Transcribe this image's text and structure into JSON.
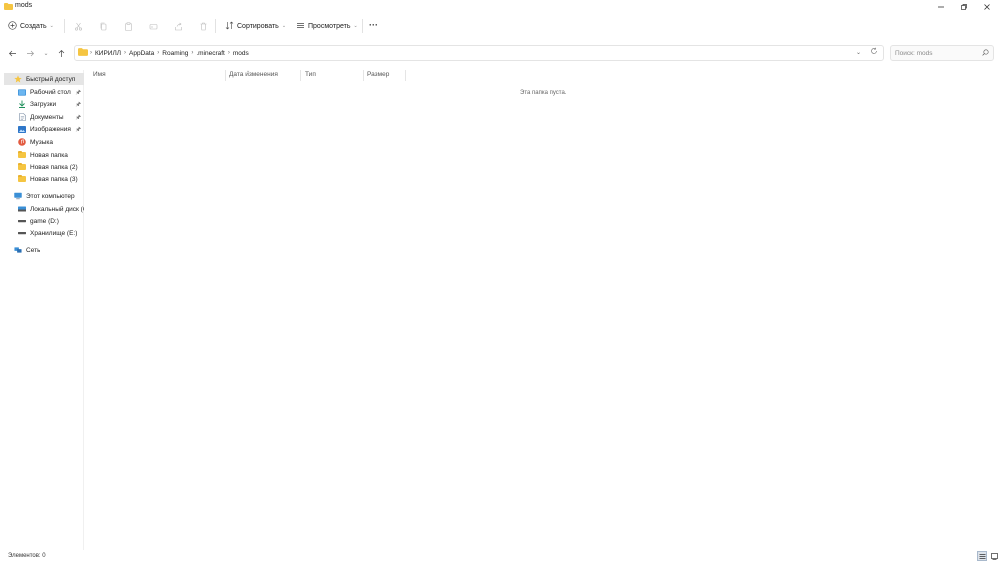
{
  "window": {
    "title": "mods"
  },
  "toolbar": {
    "new_label": "Создать",
    "sort_label": "Сортировать",
    "view_label": "Просмотреть",
    "more_label": "···",
    "icons": [
      "cut-icon",
      "copy-icon",
      "paste-icon",
      "rename-icon",
      "share-icon",
      "delete-icon"
    ]
  },
  "address": {
    "crumbs": [
      "КИРИЛЛ",
      "AppData",
      "Roaming",
      ".minecraft",
      "mods"
    ]
  },
  "search": {
    "placeholder": "Поиск: mods"
  },
  "sidebar": {
    "quick_access": "Быстрый доступ",
    "items": [
      {
        "label": "Рабочий стол",
        "pinned": true
      },
      {
        "label": "Загрузки",
        "pinned": true
      },
      {
        "label": "Документы",
        "pinned": true
      },
      {
        "label": "Изображения",
        "pinned": true
      },
      {
        "label": "Музыка",
        "pinned": false
      },
      {
        "label": "Новая папка",
        "pinned": false
      },
      {
        "label": "Новая папка (2)",
        "pinned": false
      },
      {
        "label": "Новая папка (3)",
        "pinned": false
      }
    ],
    "this_pc": "Этот компьютер",
    "drives": [
      {
        "label": "Локальный диск (C"
      },
      {
        "label": "game (D:)"
      },
      {
        "label": "Хранилище (E:)"
      }
    ],
    "network": "Сеть"
  },
  "columns": {
    "name": "Имя",
    "date": "Дата изменения",
    "type": "Тип",
    "size": "Размер"
  },
  "content": {
    "empty_text": "Эта папка пуста."
  },
  "status": {
    "items_count": "Элементов: 0"
  },
  "colors": {
    "folder": "#f5c542",
    "selection": "#e5e5e5",
    "accent": "#0067c0"
  }
}
